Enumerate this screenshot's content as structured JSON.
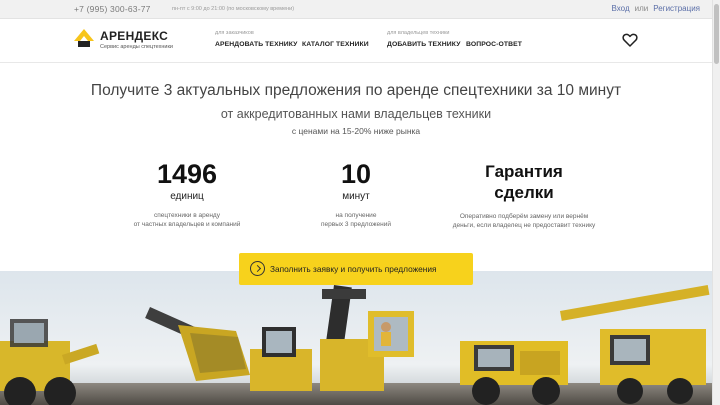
{
  "topbar": {
    "phone": "+7 (995) 300-63-77",
    "hours": "пн-пт с 9:00 до 21:00 (по московскому времени)",
    "login": "Вход",
    "or": "или",
    "register": "Регистрация"
  },
  "header": {
    "logo_name": "АРЕНДЕКС",
    "logo_sub": "Сервис аренды спецтехники",
    "nav": {
      "customers_label": "для заказчиков",
      "owners_label": "для владельцев техники",
      "rent": "АРЕНДОВАТЬ ТЕХНИКУ",
      "catalog": "КАТАЛОГ ТЕХНИКИ",
      "add": "ДОБАВИТЬ ТЕХНИКУ",
      "faq": "ВОПРОС-ОТВЕТ"
    }
  },
  "hero": {
    "title": "Получите 3 актуальных предложения по аренде спецтехники за 10 минут",
    "subtitle": "от аккредитованных нами владельцев техники",
    "subtitle2": "с ценами на 15-20% ниже рынка"
  },
  "stats": [
    {
      "value": "1496",
      "unit": "единиц",
      "desc1": "спецтехники в аренду",
      "desc2": "от частных владельцев и компаний"
    },
    {
      "value": "10",
      "unit": "минут",
      "desc1": "на получение",
      "desc2": "первых 3 предложений"
    },
    {
      "title1": "Гарантия",
      "title2": "сделки",
      "desc1": "Оперативно подберём замену или вернём",
      "desc2": "деньги, если владелец не предоставит технику"
    }
  ],
  "cta": {
    "label": "Заполнить заявку и получить предложения"
  },
  "colors": {
    "accent": "#f7d21c",
    "link": "#5b6fa8"
  },
  "icons": {
    "heart": "heart-icon",
    "arrow": "arrow-right-circle-icon",
    "logo": "logo-mark-icon"
  }
}
